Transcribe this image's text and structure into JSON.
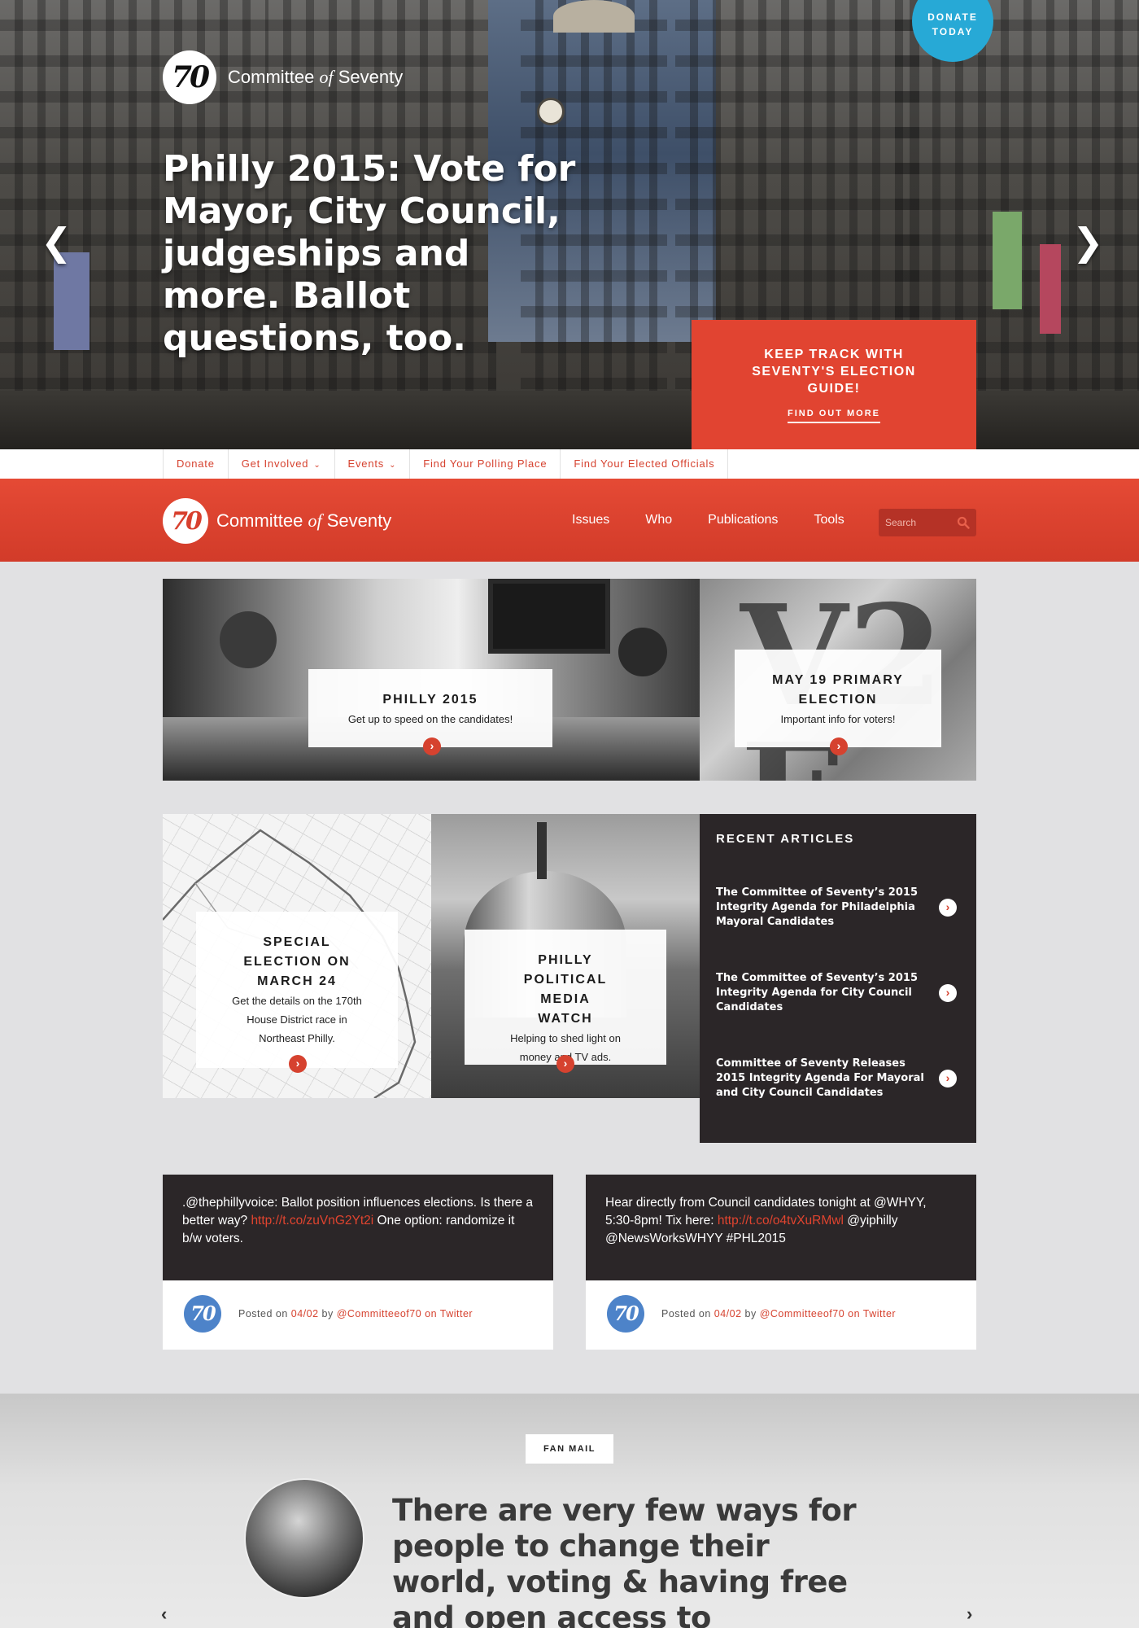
{
  "hero": {
    "logo_number": "70",
    "logo_name": "Committee",
    "logo_of": "of",
    "logo_seventy": "Seventy",
    "title": "Philly 2015: Vote for Mayor, City Council, judgeships and more. Ballot questions, too.",
    "prev_arrow": "❮",
    "next_arrow": "❯",
    "donate_line1": "DONATE",
    "donate_line2": "TODAY",
    "cta_title": "KEEP TRACK WITH SEVENTY'S ELECTION GUIDE!",
    "cta_link": "FIND OUT MORE"
  },
  "util_nav": {
    "items": [
      "Donate",
      "Get Involved",
      "Events",
      "Find Your Polling Place",
      "Find Your Elected Officials"
    ],
    "caret": "⌄"
  },
  "main_nav": {
    "logo_number": "70",
    "logo_name": "Committee",
    "logo_of": "of",
    "logo_seventy": "Seventy",
    "links": [
      "Issues",
      "Who",
      "Publications",
      "Tools"
    ],
    "search_placeholder": "Search"
  },
  "tiles": [
    {
      "title": "PHILLY 2015",
      "subtitle": "Get up to speed on the candidates!"
    },
    {
      "title": "MAY 19 PRIMARY ELECTION",
      "subtitle": "Important info for voters!",
      "bg_letters": "V2\nE"
    },
    {
      "title": "SPECIAL ELECTION ON MARCH 24",
      "subtitle": "Get the details on the 170th House District race in Northeast Philly."
    },
    {
      "title": "PHILLY POLITICAL MEDIA WATCH",
      "subtitle": "Helping to shed light on money and TV ads."
    }
  ],
  "recent": {
    "heading": "RECENT ARTICLES",
    "articles": [
      "The Committee of Seventy’s 2015 Integrity Agenda for Philadelphia Mayoral Candidates",
      "The Committee of Seventy’s 2015 Integrity Agenda for City Council Candidates",
      "Committee of Seventy Releases 2015 Integrity Agenda For Mayoral and City Council Candidates"
    ]
  },
  "tweets": [
    {
      "text_before": ".@thephillyvoice: Ballot position influences elections. Is there a better way? ",
      "link": "http://t.co/zuVnG2Yt2i",
      "text_after": " One option: randomize it b/w voters.",
      "posted_on": "Posted on ",
      "date": "04/02",
      "by": " by ",
      "handle": "@Committeeof70 on Twitter",
      "avatar": "70"
    },
    {
      "text_before": "Hear directly from Council candidates tonight at @WHYY, 5:30-8pm! Tix here: ",
      "link": "http://t.co/o4tvXuRMwl",
      "text_after": " @yiphilly @NewsWorksWHYY #PHL2015",
      "posted_on": "Posted on ",
      "date": "04/02",
      "by": " by ",
      "handle": "@Committeeof70 on Twitter",
      "avatar": "70"
    }
  ],
  "fan_mail": {
    "label": "FAN MAIL",
    "quote": "There are very few ways for people to change their world, voting & having free and open access to information to vote is",
    "prev_arrow": "‹",
    "next_arrow": "›"
  },
  "colors": {
    "brand_red": "#e14431",
    "donate_blue": "#27a9d6",
    "dark_panel": "#2b2628",
    "twitter_avatar_blue": "#4d83c9"
  },
  "icons": {
    "search": "search-icon",
    "go": "chevron-right-icon"
  }
}
